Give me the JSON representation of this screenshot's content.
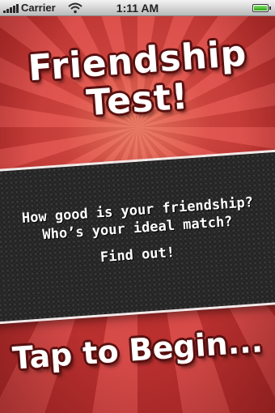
{
  "status_bar": {
    "carrier": "Carrier",
    "time": "1:11 AM",
    "battery_level": 1.0,
    "icons": [
      "signal-icon",
      "wifi-icon",
      "battery-icon"
    ]
  },
  "title": {
    "line1": "Friendship",
    "line2": "Test!"
  },
  "intro": {
    "question1": "How good is your friendship?",
    "question2": "Who’s your ideal match?",
    "call_to_action": "Find out!"
  },
  "begin": {
    "label": "Tap to Begin..."
  },
  "colors": {
    "background_red": "#d13f3f",
    "band_dark": "#242424",
    "text": "#ffffff"
  }
}
